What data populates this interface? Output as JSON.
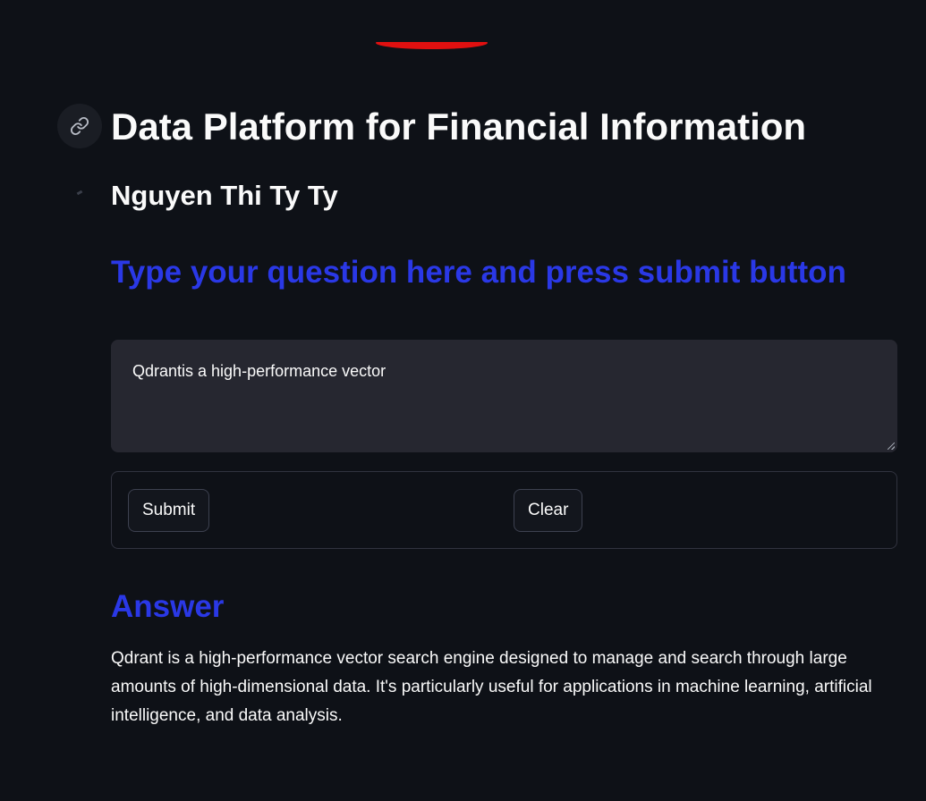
{
  "header": {
    "title": "Data Platform for Financial Information",
    "author": "Nguyen Thi Ty Ty",
    "instruction": "Type your question here and press submit button"
  },
  "question": {
    "value": "Qdrantis a high-performance vector"
  },
  "form": {
    "submit_label": "Submit",
    "clear_label": "Clear"
  },
  "answer": {
    "heading": "Answer",
    "text": "Qdrant is a high-performance vector search engine designed to manage and search through large amounts of high-dimensional data. It's particularly useful for applications in machine learning, artificial intelligence, and data analysis."
  },
  "icons": {
    "anchor": "link-icon"
  },
  "colors": {
    "background": "#0e1117",
    "accent_heading": "#2a38e6",
    "input_background": "#262730",
    "text": "#fafafa",
    "decoration": "#e01010"
  }
}
